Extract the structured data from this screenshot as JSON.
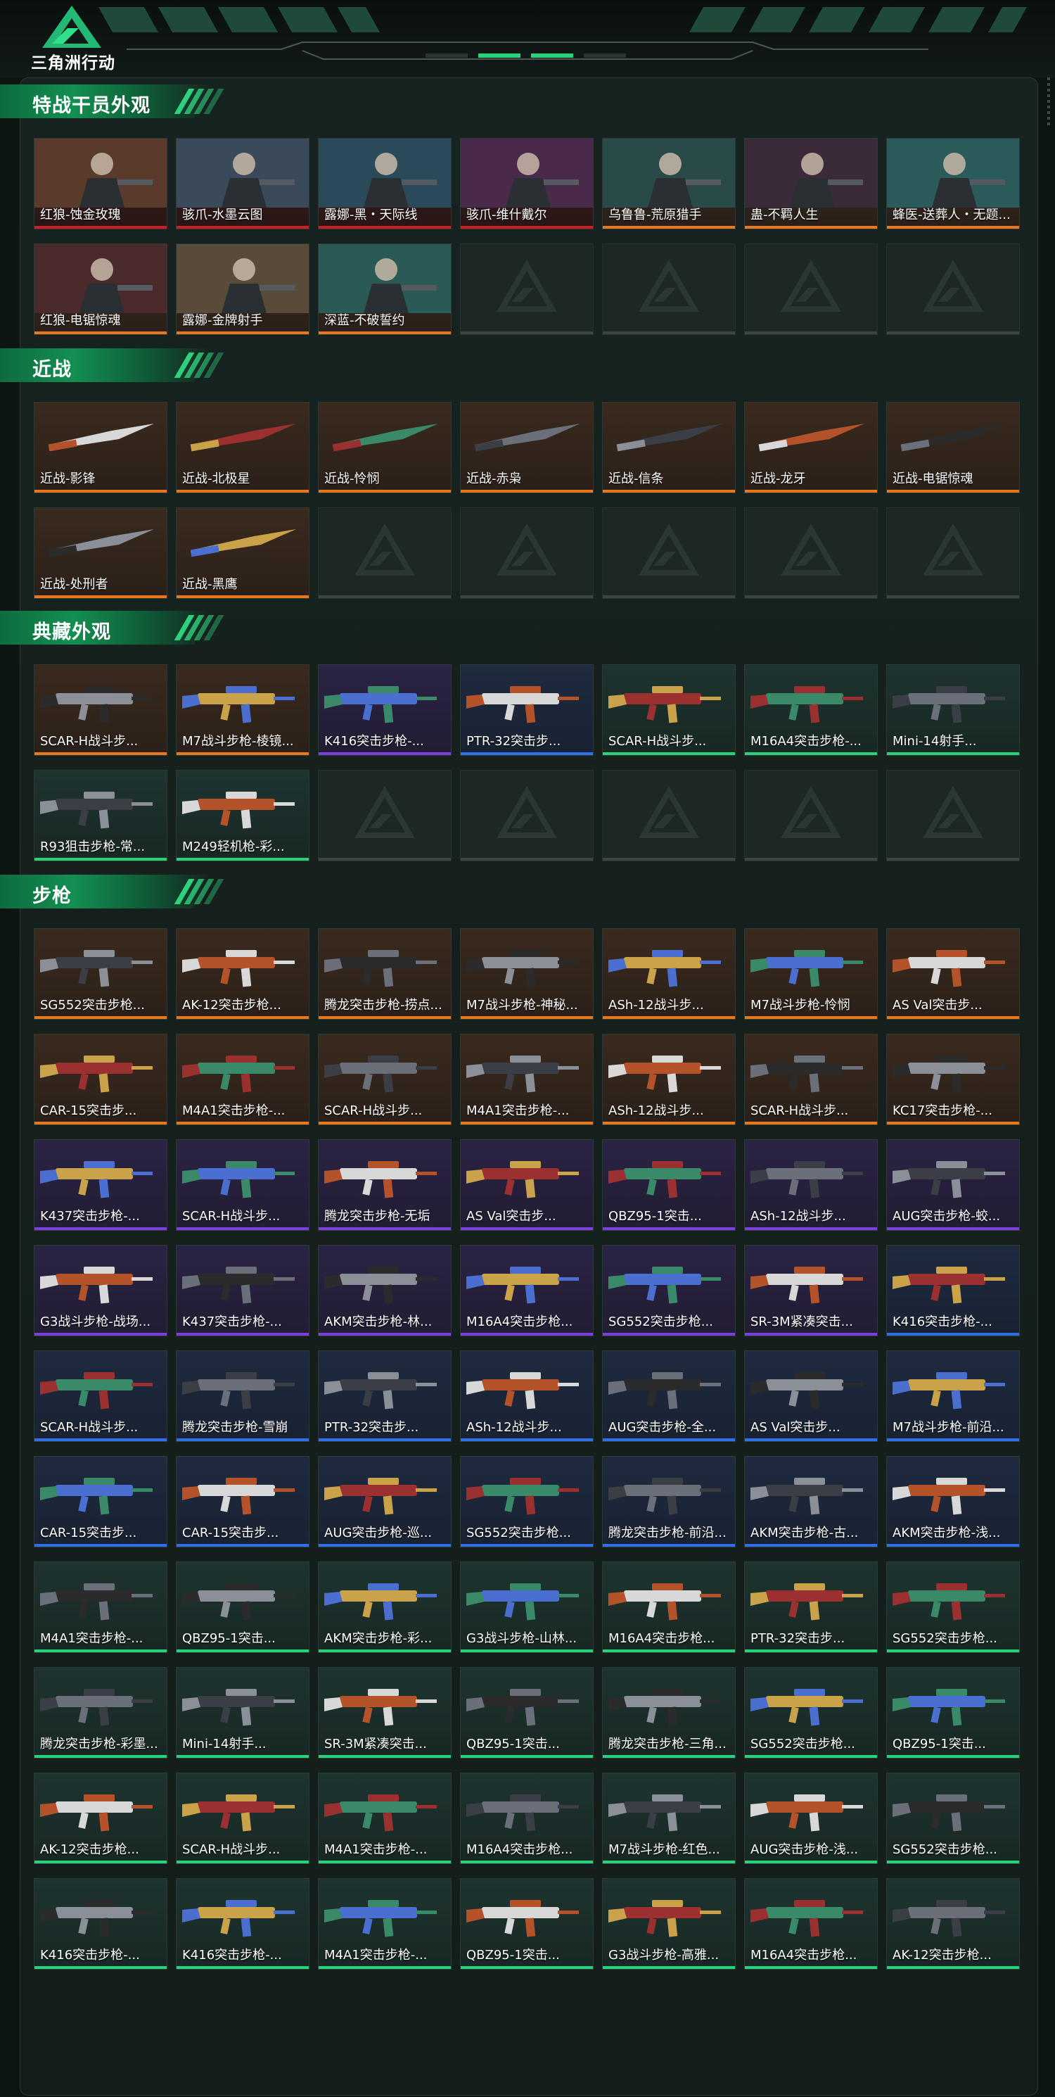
{
  "app": {
    "logo_text": "三角洲行动"
  },
  "colors": {
    "accent": "#29d17a",
    "rarity_red": "#c81e24",
    "rarity_orange": "#e8781c",
    "rarity_purple": "#7b3fe0",
    "rarity_blue": "#2f6fe8",
    "rarity_green": "#29d17a"
  },
  "sections": [
    {
      "title": "特战干员外观",
      "kind": "operator",
      "items": [
        {
          "label": "红狼-蚀金玫瑰",
          "rarity": "red",
          "art_text": "蚀金玫瑰"
        },
        {
          "label": "骇爪-水墨云图",
          "rarity": "red",
          "art_text": "水墨云图"
        },
        {
          "label": "露娜-黑・天际线",
          "rarity": "red",
          "art_text": "天际线"
        },
        {
          "label": "骇爪-维什戴尔",
          "rarity": "red",
          "art_text": "维什戴尔"
        },
        {
          "label": "乌鲁鲁-荒原猎手",
          "rarity": "orange",
          "art_text": "荒原猎手"
        },
        {
          "label": "蛊-不羁人生",
          "rarity": "orange",
          "art_text": "不羁人生"
        },
        {
          "label": "蜂医-送葬人・无题...",
          "rarity": "orange",
          "art_text": "无题"
        },
        {
          "label": "红狼-电锯惊魂",
          "rarity": "orange",
          "art_text": ""
        },
        {
          "label": "露娜-金牌射手",
          "rarity": "orange",
          "art_text": ""
        },
        {
          "label": "深蓝-不破誓约",
          "rarity": "orange",
          "art_text": "不破誓约"
        }
      ]
    },
    {
      "title": "近战",
      "kind": "melee",
      "items": [
        {
          "label": "近战-影锋",
          "rarity": "orange"
        },
        {
          "label": "近战-北极星",
          "rarity": "orange"
        },
        {
          "label": "近战-怜悯",
          "rarity": "orange"
        },
        {
          "label": "近战-赤枭",
          "rarity": "orange"
        },
        {
          "label": "近战-信条",
          "rarity": "orange"
        },
        {
          "label": "近战-龙牙",
          "rarity": "orange"
        },
        {
          "label": "近战-电锯惊魂",
          "rarity": "orange"
        },
        {
          "label": "近战-处刑者",
          "rarity": "orange"
        },
        {
          "label": "近战-黑鹰",
          "rarity": "orange"
        }
      ]
    },
    {
      "title": "典藏外观",
      "kind": "gun",
      "items": [
        {
          "label": "SCAR-H战斗步...",
          "rarity": "orange"
        },
        {
          "label": "M7战斗步枪-棱镜...",
          "rarity": "orange"
        },
        {
          "label": "K416突击步枪-...",
          "rarity": "purple"
        },
        {
          "label": "PTR-32突击步...",
          "rarity": "blue"
        },
        {
          "label": "SCAR-H战斗步...",
          "rarity": "green"
        },
        {
          "label": "M16A4突击步枪-...",
          "rarity": "green"
        },
        {
          "label": "Mini-14射手...",
          "rarity": "green"
        },
        {
          "label": "R93狙击步枪-常...",
          "rarity": "green"
        },
        {
          "label": "M249轻机枪-彩...",
          "rarity": "green"
        }
      ]
    },
    {
      "title": "步枪",
      "kind": "gun",
      "items": [
        {
          "label": "SG552突击步枪...",
          "rarity": "orange"
        },
        {
          "label": "AK-12突击步枪...",
          "rarity": "orange"
        },
        {
          "label": "腾龙突击步枪-捞点...",
          "rarity": "orange"
        },
        {
          "label": "M7战斗步枪-神秘...",
          "rarity": "orange"
        },
        {
          "label": "ASh-12战斗步...",
          "rarity": "orange"
        },
        {
          "label": "M7战斗步枪-怜悯",
          "rarity": "orange"
        },
        {
          "label": "AS Val突击步...",
          "rarity": "orange"
        },
        {
          "label": "CAR-15突击步...",
          "rarity": "orange"
        },
        {
          "label": "M4A1突击步枪-...",
          "rarity": "orange"
        },
        {
          "label": "SCAR-H战斗步...",
          "rarity": "orange"
        },
        {
          "label": "M4A1突击步枪-...",
          "rarity": "orange"
        },
        {
          "label": "ASh-12战斗步...",
          "rarity": "orange"
        },
        {
          "label": "SCAR-H战斗步...",
          "rarity": "orange"
        },
        {
          "label": "KC17突击步枪-...",
          "rarity": "orange"
        },
        {
          "label": "K437突击步枪-...",
          "rarity": "purple"
        },
        {
          "label": "SCAR-H战斗步...",
          "rarity": "purple"
        },
        {
          "label": "腾龙突击步枪-无垢",
          "rarity": "purple"
        },
        {
          "label": "AS Val突击步...",
          "rarity": "purple"
        },
        {
          "label": "QBZ95-1突击...",
          "rarity": "purple"
        },
        {
          "label": "ASh-12战斗步...",
          "rarity": "purple"
        },
        {
          "label": "AUG突击步枪-蛟...",
          "rarity": "purple"
        },
        {
          "label": "G3战斗步枪-战场...",
          "rarity": "purple"
        },
        {
          "label": "K437突击步枪-...",
          "rarity": "purple"
        },
        {
          "label": "AKM突击步枪-林...",
          "rarity": "purple"
        },
        {
          "label": "M16A4突击步枪...",
          "rarity": "purple"
        },
        {
          "label": "SG552突击步枪...",
          "rarity": "purple"
        },
        {
          "label": "SR-3M紧凑突击...",
          "rarity": "purple"
        },
        {
          "label": "K416突击步枪-...",
          "rarity": "blue"
        },
        {
          "label": "SCAR-H战斗步...",
          "rarity": "blue"
        },
        {
          "label": "腾龙突击步枪-雪崩",
          "rarity": "blue"
        },
        {
          "label": "PTR-32突击步...",
          "rarity": "blue"
        },
        {
          "label": "ASh-12战斗步...",
          "rarity": "blue"
        },
        {
          "label": "AUG突击步枪-全...",
          "rarity": "blue"
        },
        {
          "label": "AS Val突击步...",
          "rarity": "blue"
        },
        {
          "label": "M7战斗步枪-前沿...",
          "rarity": "blue"
        },
        {
          "label": "CAR-15突击步...",
          "rarity": "blue"
        },
        {
          "label": "CAR-15突击步...",
          "rarity": "blue"
        },
        {
          "label": "AUG突击步枪-巡...",
          "rarity": "blue"
        },
        {
          "label": "SG552突击步枪...",
          "rarity": "blue"
        },
        {
          "label": "腾龙突击步枪-前沿...",
          "rarity": "blue"
        },
        {
          "label": "AKM突击步枪-古...",
          "rarity": "blue"
        },
        {
          "label": "AKM突击步枪-浅...",
          "rarity": "blue"
        },
        {
          "label": "M4A1突击步枪-...",
          "rarity": "green"
        },
        {
          "label": "QBZ95-1突击...",
          "rarity": "green"
        },
        {
          "label": "AKM突击步枪-彩...",
          "rarity": "green"
        },
        {
          "label": "G3战斗步枪-山林...",
          "rarity": "green"
        },
        {
          "label": "M16A4突击步枪...",
          "rarity": "green"
        },
        {
          "label": "PTR-32突击步...",
          "rarity": "green"
        },
        {
          "label": "SG552突击步枪...",
          "rarity": "green"
        },
        {
          "label": "腾龙突击步枪-彩墨...",
          "rarity": "green"
        },
        {
          "label": "Mini-14射手...",
          "rarity": "green"
        },
        {
          "label": "SR-3M紧凑突击...",
          "rarity": "green"
        },
        {
          "label": "QBZ95-1突击...",
          "rarity": "green"
        },
        {
          "label": "腾龙突击步枪-三角...",
          "rarity": "green"
        },
        {
          "label": "SG552突击步枪...",
          "rarity": "green"
        },
        {
          "label": "QBZ95-1突击...",
          "rarity": "green"
        },
        {
          "label": "AK-12突击步枪...",
          "rarity": "green"
        },
        {
          "label": "SCAR-H战斗步...",
          "rarity": "green"
        },
        {
          "label": "M4A1突击步枪-...",
          "rarity": "green"
        },
        {
          "label": "M16A4突击步枪...",
          "rarity": "green"
        },
        {
          "label": "M7战斗步枪-红色...",
          "rarity": "green"
        },
        {
          "label": "AUG突击步枪-浅...",
          "rarity": "green"
        },
        {
          "label": "SG552突击步枪...",
          "rarity": "green"
        },
        {
          "label": "K416突击步枪-...",
          "rarity": "green"
        },
        {
          "label": "K416突击步枪-...",
          "rarity": "green"
        },
        {
          "label": "M4A1突击步枪-...",
          "rarity": "green"
        },
        {
          "label": "QBZ95-1突击...",
          "rarity": "green"
        },
        {
          "label": "G3战斗步枪-高雅...",
          "rarity": "green"
        },
        {
          "label": "M16A4突击步枪...",
          "rarity": "green"
        },
        {
          "label": "AK-12突击步枪...",
          "rarity": "green"
        }
      ]
    }
  ]
}
